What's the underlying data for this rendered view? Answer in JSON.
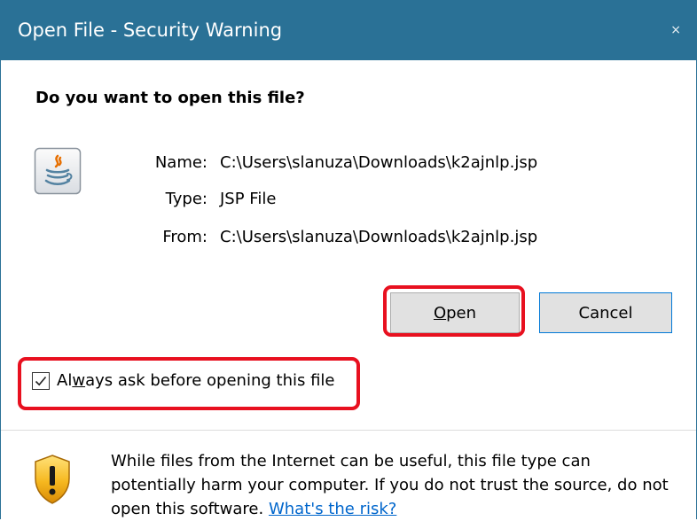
{
  "window": {
    "title": "Open File - Security Warning",
    "close_glyph": "×"
  },
  "question": "Do you want to open this file?",
  "file_icon": "java-icon",
  "file_info": {
    "name_label": "Name:",
    "name_value": "C:\\Users\\slanuza\\Downloads\\k2ajnlp.jsp",
    "type_label": "Type:",
    "type_value": "JSP File",
    "from_label": "From:",
    "from_value": "C:\\Users\\slanuza\\Downloads\\k2ajnlp.jsp"
  },
  "buttons": {
    "open_mnemonic": "O",
    "open_rest": "pen",
    "cancel": "Cancel"
  },
  "checkbox": {
    "checked": true,
    "label_pre": "Al",
    "label_mnemonic": "w",
    "label_post": "ays ask before opening this file"
  },
  "warning": {
    "icon": "shield-warning-icon",
    "text": "While files from the Internet can be useful, this file type can potentially harm your computer. If you do not trust the source, do not open this software.",
    "link": "What's the risk?"
  },
  "colors": {
    "titlebar": "#2a7196",
    "highlight": "#e8101f",
    "link": "#0066cc",
    "button_bg": "#e1e1e1"
  }
}
